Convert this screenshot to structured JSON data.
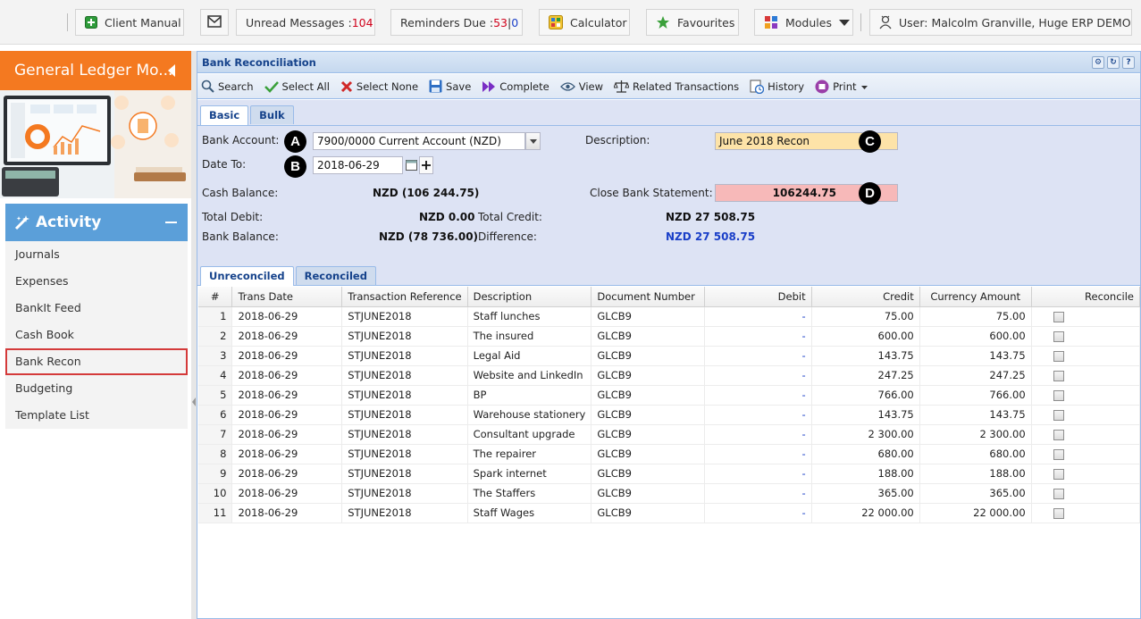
{
  "topbar": {
    "client_manual": "Client Manual",
    "unread_label": "Unread Messages : ",
    "unread_count": "104",
    "reminders_label": "Reminders Due : ",
    "reminders_count_a": "53",
    "reminders_sep": "|",
    "reminders_count_b": "0",
    "calculator": "Calculator",
    "favourites": "Favourites",
    "modules": "Modules",
    "user": "User: Malcolm Granville, Huge ERP DEMO"
  },
  "sidebar": {
    "module_title": "General Ledger Mo...",
    "activity_title": "Activity",
    "items": [
      {
        "label": "Journals"
      },
      {
        "label": "Expenses"
      },
      {
        "label": "BankIt Feed"
      },
      {
        "label": "Cash Book"
      },
      {
        "label": "Bank Recon",
        "selected": true
      },
      {
        "label": "Budgeting"
      },
      {
        "label": "Template List"
      }
    ]
  },
  "panel": {
    "title": "Bank Reconciliation",
    "toolbar": {
      "search": "Search",
      "select_all": "Select All",
      "select_none": "Select None",
      "save": "Save",
      "complete": "Complete",
      "view": "View",
      "related": "Related Transactions",
      "history": "History",
      "print": "Print"
    },
    "form_tabs": [
      "Basic",
      "Bulk"
    ],
    "form": {
      "bank_account_label": "Bank Account:",
      "bank_account_value": "7900/0000 Current Account (NZD)",
      "date_to_label": "Date To:",
      "date_to_value": "2018-06-29",
      "description_label": "Description:",
      "description_value": "June 2018 Recon",
      "cash_balance_label": "Cash Balance:",
      "cash_balance_value": "NZD (106 244.75)",
      "close_statement_label": "Close Bank Statement:",
      "close_statement_value": "106244.75",
      "total_debit_label": "Total Debit:",
      "total_debit_value": "NZD 0.00",
      "total_credit_label": "Total Credit:",
      "total_credit_value": "NZD 27 508.75",
      "bank_balance_label": "Bank Balance:",
      "bank_balance_value": "NZD (78 736.00)",
      "difference_label": "Difference:",
      "difference_value": "NZD 27 508.75"
    },
    "callouts": {
      "a": "A",
      "b": "B",
      "c": "C",
      "d": "D"
    },
    "grid_tabs": [
      "Unreconciled",
      "Reconciled"
    ],
    "grid": {
      "columns": [
        "#",
        "Trans Date",
        "Transaction Reference",
        "Description",
        "Document Number",
        "Debit",
        "Credit",
        "Currency Amount",
        "Reconcile"
      ],
      "rows": [
        {
          "n": "1",
          "date": "2018-06-29",
          "ref": "STJUNE2018",
          "desc": "Staff lunches",
          "doc": "GLCB9",
          "debit": "-",
          "credit": "75.00",
          "curr": "75.00"
        },
        {
          "n": "2",
          "date": "2018-06-29",
          "ref": "STJUNE2018",
          "desc": "The insured",
          "doc": "GLCB9",
          "debit": "-",
          "credit": "600.00",
          "curr": "600.00"
        },
        {
          "n": "3",
          "date": "2018-06-29",
          "ref": "STJUNE2018",
          "desc": "Legal Aid",
          "doc": "GLCB9",
          "debit": "-",
          "credit": "143.75",
          "curr": "143.75"
        },
        {
          "n": "4",
          "date": "2018-06-29",
          "ref": "STJUNE2018",
          "desc": "Website and LinkedIn",
          "doc": "GLCB9",
          "debit": "-",
          "credit": "247.25",
          "curr": "247.25"
        },
        {
          "n": "5",
          "date": "2018-06-29",
          "ref": "STJUNE2018",
          "desc": "BP",
          "doc": "GLCB9",
          "debit": "-",
          "credit": "766.00",
          "curr": "766.00"
        },
        {
          "n": "6",
          "date": "2018-06-29",
          "ref": "STJUNE2018",
          "desc": "Warehouse stationery",
          "doc": "GLCB9",
          "debit": "-",
          "credit": "143.75",
          "curr": "143.75"
        },
        {
          "n": "7",
          "date": "2018-06-29",
          "ref": "STJUNE2018",
          "desc": "Consultant upgrade",
          "doc": "GLCB9",
          "debit": "-",
          "credit": "2 300.00",
          "curr": "2 300.00"
        },
        {
          "n": "8",
          "date": "2018-06-29",
          "ref": "STJUNE2018",
          "desc": "The repairer",
          "doc": "GLCB9",
          "debit": "-",
          "credit": "680.00",
          "curr": "680.00"
        },
        {
          "n": "9",
          "date": "2018-06-29",
          "ref": "STJUNE2018",
          "desc": "Spark internet",
          "doc": "GLCB9",
          "debit": "-",
          "credit": "188.00",
          "curr": "188.00"
        },
        {
          "n": "10",
          "date": "2018-06-29",
          "ref": "STJUNE2018",
          "desc": "The Staffers",
          "doc": "GLCB9",
          "debit": "-",
          "credit": "365.00",
          "curr": "365.00"
        },
        {
          "n": "11",
          "date": "2018-06-29",
          "ref": "STJUNE2018",
          "desc": "Staff Wages",
          "doc": "GLCB9",
          "debit": "-",
          "credit": "22 000.00",
          "curr": "22 000.00"
        }
      ]
    }
  },
  "colors": {
    "accent_orange": "#f47920",
    "activity_blue": "#5b9fd9",
    "panel_border": "#99bbe8",
    "description_bg": "#fde3a8",
    "close_stmt_bg": "#f7b9b9",
    "difference_blue": "#1a3fc8",
    "unread_red": "#d0021b"
  }
}
